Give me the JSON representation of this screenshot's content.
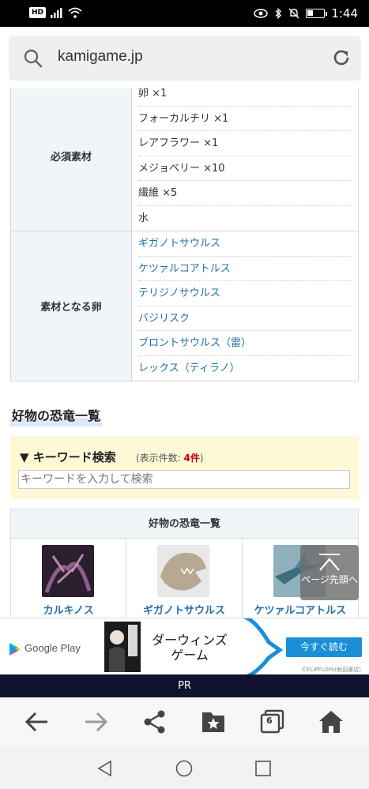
{
  "status_bar": {
    "hd_badge": "HD",
    "time": "1:44",
    "battery_level": 0.35,
    "icons": [
      "signal-icon",
      "wifi-icon",
      "eye-comfort-icon",
      "bluetooth-icon",
      "mute-icon",
      "battery-icon"
    ]
  },
  "browser": {
    "url": "kamigame.jp",
    "tab_count": "6"
  },
  "page": {
    "materials_table": [
      {
        "header": "必須素材",
        "link": false,
        "rows": [
          "卵 ×1",
          "フォーカルチリ ×1",
          "レアフラワー ×1",
          "メジョベリー ×10",
          "繊維 ×5",
          "水"
        ]
      },
      {
        "header": "素材となる卵",
        "link": true,
        "rows": [
          "ギガノトサウルス",
          "ケツァルコアトルス",
          "テリジノサウルス",
          "バジリスク",
          "ブロントサウルス（雷）",
          "レックス（ティラノ）"
        ]
      }
    ],
    "section_title": "好物の恐竜一覧",
    "keyword_search": {
      "title": "▼ キーワード検索",
      "count_prefix": "(表示件数: ",
      "count_value": "4件",
      "count_suffix": ")",
      "placeholder": "キーワードを入力して検索"
    },
    "dino_panel": {
      "title": "好物の恐竜一覧",
      "items": [
        {
          "name": "カルキノス",
          "thumb_color": "#5b3a5a"
        },
        {
          "name": "ギガノトサウルス",
          "thumb_color": "#a89a86"
        },
        {
          "name": "ケツァルコアトルス",
          "thumb_color": "#4a7c8e"
        }
      ]
    },
    "page_top_button": "ページ先頭へ"
  },
  "ad": {
    "store": "Google Play",
    "title": "ダーウィンズゲーム",
    "cta": "今すぐ読む",
    "credit": "©FLIPFLOPs(秋田書店)",
    "pr_label": "PR"
  },
  "colors": {
    "link": "#1f6fa8",
    "table_header_bg": "#f0f6f8",
    "keyword_bg": "#fdf9d6",
    "count_red": "#c8000a",
    "ad_cta": "#1a8fd8",
    "pr_bar": "#111132"
  }
}
